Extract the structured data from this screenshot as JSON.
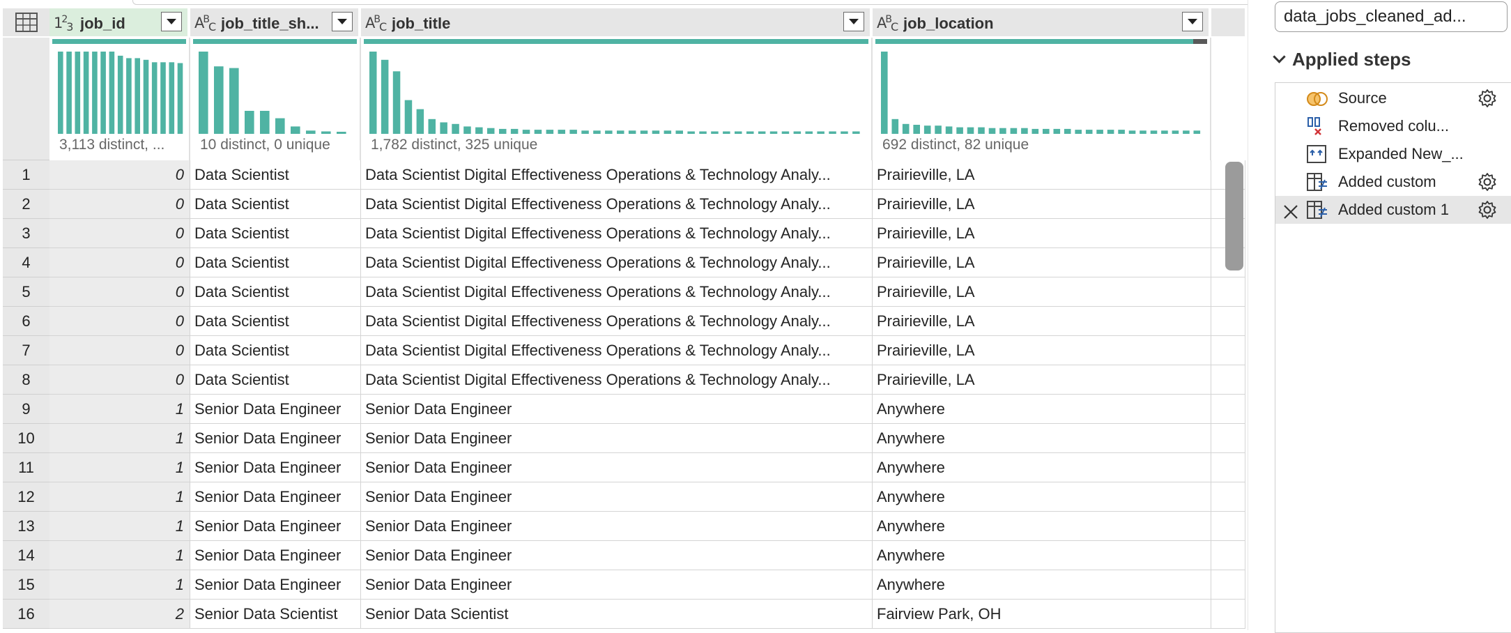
{
  "columns": [
    {
      "name": "job_id",
      "type_icon": "number-type-icon",
      "stats": "3,113 distinct, ..."
    },
    {
      "name": "job_title_sh...",
      "type_icon": "text-type-icon",
      "stats": "10 distinct, 0 unique"
    },
    {
      "name": "job_title",
      "type_icon": "text-type-icon",
      "stats": "1,782 distinct, 325 unique"
    },
    {
      "name": "job_location",
      "type_icon": "text-type-icon",
      "stats": "692 distinct, 82 unique"
    }
  ],
  "rows": [
    {
      "n": "1",
      "job_id": "0",
      "short": "Data Scientist",
      "title": "Data Scientist Digital Effectiveness Operations & Technology Analy...",
      "loc": "Prairieville, LA"
    },
    {
      "n": "2",
      "job_id": "0",
      "short": "Data Scientist",
      "title": "Data Scientist Digital Effectiveness Operations & Technology Analy...",
      "loc": "Prairieville, LA"
    },
    {
      "n": "3",
      "job_id": "0",
      "short": "Data Scientist",
      "title": "Data Scientist Digital Effectiveness Operations & Technology Analy...",
      "loc": "Prairieville, LA"
    },
    {
      "n": "4",
      "job_id": "0",
      "short": "Data Scientist",
      "title": "Data Scientist Digital Effectiveness Operations & Technology Analy...",
      "loc": "Prairieville, LA"
    },
    {
      "n": "5",
      "job_id": "0",
      "short": "Data Scientist",
      "title": "Data Scientist Digital Effectiveness Operations & Technology Analy...",
      "loc": "Prairieville, LA"
    },
    {
      "n": "6",
      "job_id": "0",
      "short": "Data Scientist",
      "title": "Data Scientist Digital Effectiveness Operations & Technology Analy...",
      "loc": "Prairieville, LA"
    },
    {
      "n": "7",
      "job_id": "0",
      "short": "Data Scientist",
      "title": "Data Scientist Digital Effectiveness Operations & Technology Analy...",
      "loc": "Prairieville, LA"
    },
    {
      "n": "8",
      "job_id": "0",
      "short": "Data Scientist",
      "title": "Data Scientist Digital Effectiveness Operations & Technology Analy...",
      "loc": "Prairieville, LA"
    },
    {
      "n": "9",
      "job_id": "1",
      "short": "Senior Data Engineer",
      "title": "Senior Data Engineer",
      "loc": "Anywhere"
    },
    {
      "n": "10",
      "job_id": "1",
      "short": "Senior Data Engineer",
      "title": "Senior Data Engineer",
      "loc": "Anywhere"
    },
    {
      "n": "11",
      "job_id": "1",
      "short": "Senior Data Engineer",
      "title": "Senior Data Engineer",
      "loc": "Anywhere"
    },
    {
      "n": "12",
      "job_id": "1",
      "short": "Senior Data Engineer",
      "title": "Senior Data Engineer",
      "loc": "Anywhere"
    },
    {
      "n": "13",
      "job_id": "1",
      "short": "Senior Data Engineer",
      "title": "Senior Data Engineer",
      "loc": "Anywhere"
    },
    {
      "n": "14",
      "job_id": "1",
      "short": "Senior Data Engineer",
      "title": "Senior Data Engineer",
      "loc": "Anywhere"
    },
    {
      "n": "15",
      "job_id": "1",
      "short": "Senior Data Engineer",
      "title": "Senior Data Engineer",
      "loc": "Anywhere"
    },
    {
      "n": "16",
      "job_id": "2",
      "short": "Senior Data Scientist",
      "title": "Senior Data Scientist",
      "loc": "Fairview Park, OH"
    }
  ],
  "profile_bars": {
    "job_id": [
      1,
      1,
      1,
      1,
      1,
      1,
      1,
      0.95,
      0.92,
      0.92,
      0.9,
      0.87,
      0.87,
      0.87,
      0.86
    ],
    "job_title_short": [
      1,
      0.82,
      0.8,
      0.28,
      0.28,
      0.19,
      0.09,
      0.04,
      0.03,
      0.01
    ],
    "job_title": [
      1,
      0.9,
      0.76,
      0.41,
      0.3,
      0.18,
      0.14,
      0.12,
      0.09,
      0.08,
      0.07,
      0.06,
      0.06,
      0.05,
      0.05,
      0.05,
      0.05,
      0.05,
      0.04,
      0.04,
      0.04,
      0.04,
      0.04,
      0.04,
      0.04,
      0.04,
      0.04,
      0.03,
      0.03,
      0.03,
      0.03,
      0.03,
      0.03,
      0.03,
      0.03,
      0.03,
      0.03,
      0.03,
      0.03,
      0.03,
      0.03,
      0.03
    ],
    "job_location": [
      1,
      0.18,
      0.12,
      0.11,
      0.1,
      0.1,
      0.09,
      0.08,
      0.08,
      0.08,
      0.07,
      0.07,
      0.07,
      0.07,
      0.06,
      0.06,
      0.06,
      0.06,
      0.05,
      0.05,
      0.05,
      0.05,
      0.05,
      0.04,
      0.04,
      0.04,
      0.04,
      0.04,
      0.04,
      0.04
    ]
  },
  "pane": {
    "query_name": "data_jobs_cleaned_ad...",
    "applied_steps_label": "Applied steps",
    "steps": [
      {
        "label": "Source",
        "icon": "source-icon",
        "gear": true
      },
      {
        "label": "Removed colu...",
        "icon": "removed-columns-icon",
        "gear": false
      },
      {
        "label": "Expanded New_...",
        "icon": "expanded-icon",
        "gear": false
      },
      {
        "label": "Added custom",
        "icon": "custom-column-icon",
        "gear": true
      },
      {
        "label": "Added custom 1",
        "icon": "custom-column-icon",
        "gear": true
      }
    ]
  },
  "colors": {
    "accent": "#4fb3a3",
    "selected_header": "#dbeedd"
  }
}
